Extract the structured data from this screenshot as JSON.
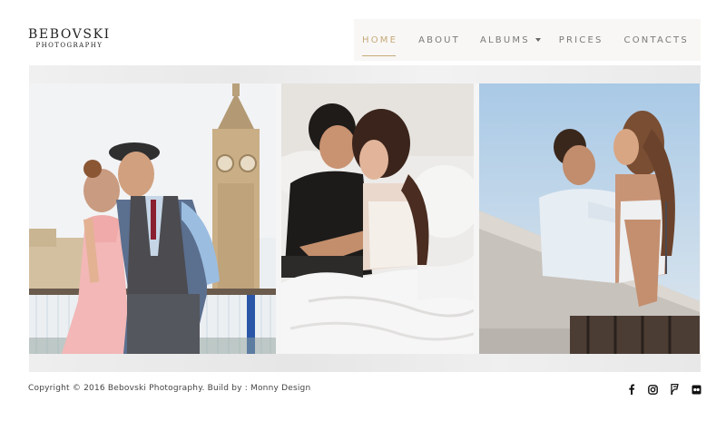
{
  "brand": {
    "name": "BEBOVSKI",
    "tagline": "PHOTOGRAPHY"
  },
  "nav": {
    "items": [
      {
        "label": "HOME",
        "active": true
      },
      {
        "label": "ABOUT",
        "active": false
      },
      {
        "label": "ALBUMS",
        "active": false,
        "has_dropdown": true
      },
      {
        "label": "PRICES",
        "active": false
      },
      {
        "label": "CONTACTS",
        "active": false
      }
    ]
  },
  "gallery": {
    "photos": [
      {
        "subject": "couple-kissing-london"
      },
      {
        "subject": "couple-bed-embrace"
      },
      {
        "subject": "couple-rooftop-railing"
      }
    ]
  },
  "footer": {
    "copyright": "Copyright © 2016 Bebovski Photography. Build by : Monny Design",
    "social_icons": [
      "facebook-icon",
      "instagram-icon",
      "foursquare-icon",
      "flickr-icon"
    ]
  },
  "colors": {
    "accent": "#c6a97a",
    "nav_text": "#7a7a7a",
    "nav_bg": "#f8f7f5"
  }
}
